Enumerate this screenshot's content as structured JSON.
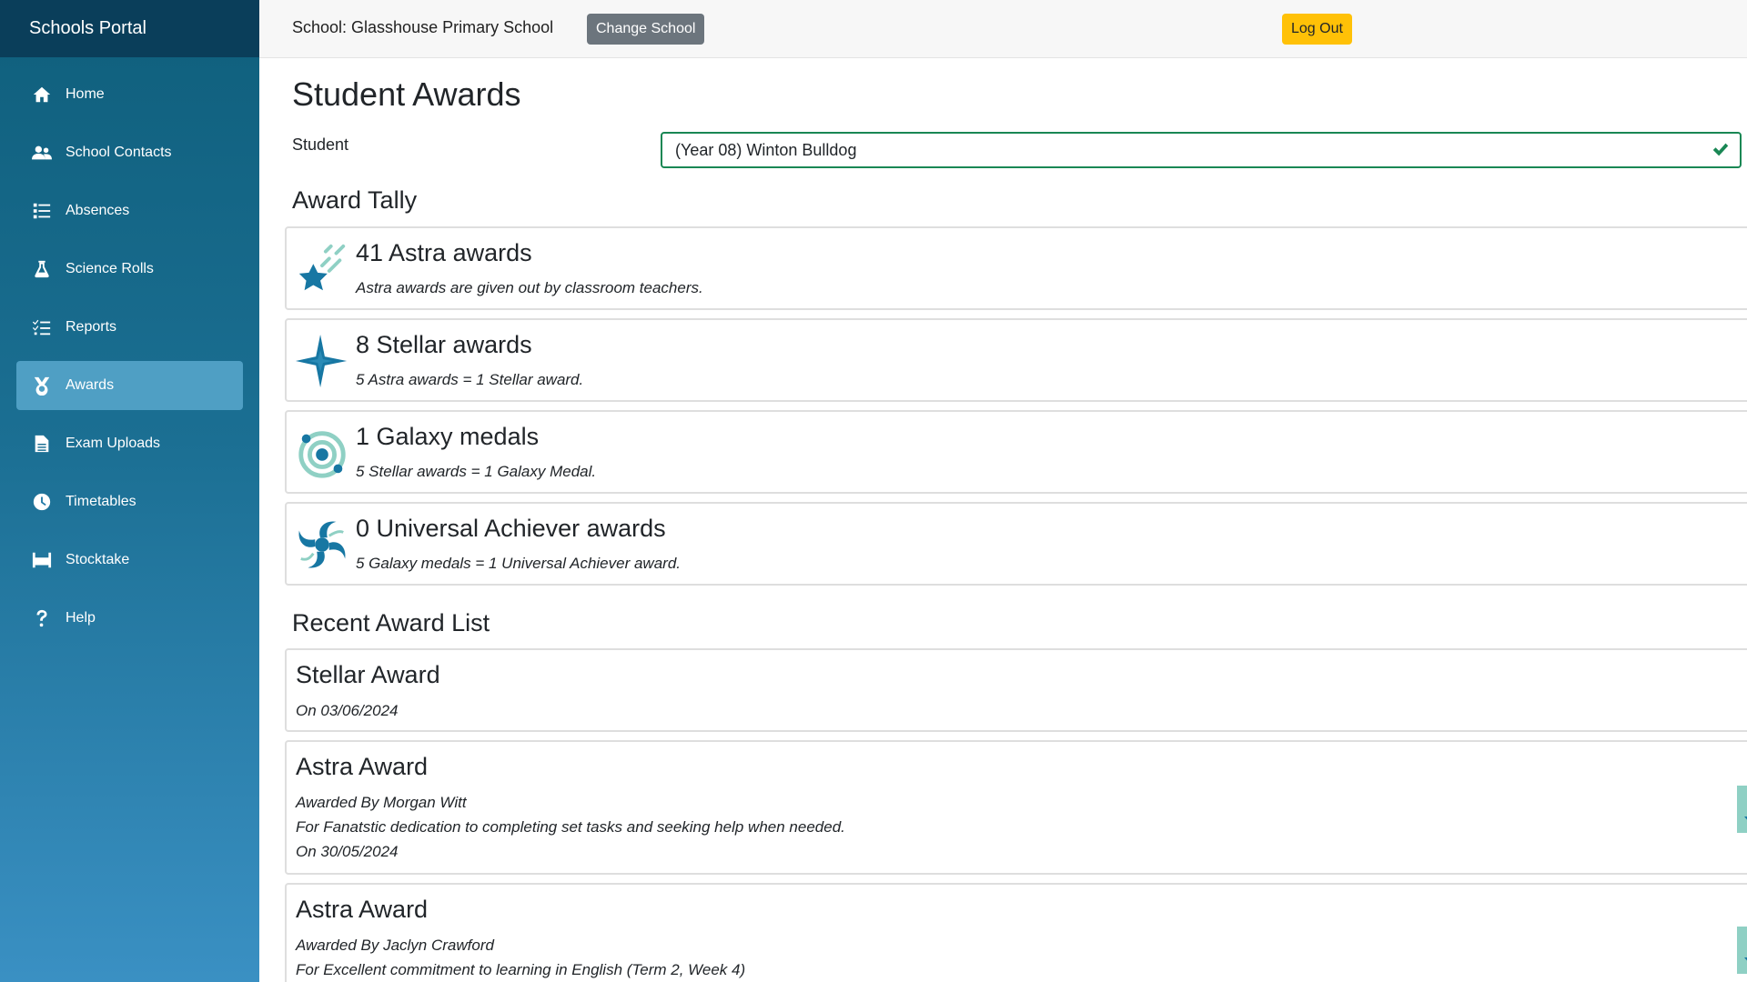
{
  "app": {
    "brand": "Schools Portal"
  },
  "sidebar": {
    "items": [
      {
        "label": "Home",
        "icon": "home-icon"
      },
      {
        "label": "School Contacts",
        "icon": "users-icon"
      },
      {
        "label": "Absences",
        "icon": "list-icon"
      },
      {
        "label": "Science Rolls",
        "icon": "flask-icon"
      },
      {
        "label": "Reports",
        "icon": "list-check-icon"
      },
      {
        "label": "Awards",
        "icon": "medal-icon",
        "active": true
      },
      {
        "label": "Exam Uploads",
        "icon": "file-icon"
      },
      {
        "label": "Timetables",
        "icon": "clock-icon"
      },
      {
        "label": "Stocktake",
        "icon": "warehouse-icon"
      },
      {
        "label": "Help",
        "icon": "question-icon"
      }
    ]
  },
  "topbar": {
    "school_label": "School: Glasshouse Primary School",
    "change_school": "Change School",
    "logout": "Log Out"
  },
  "page": {
    "title": "Student Awards",
    "student_label": "Student",
    "student_value": "(Year 08) Winton Bulldog"
  },
  "tally": {
    "title": "Award Tally",
    "items": [
      {
        "title": "41 Astra awards",
        "desc": "Astra awards are given out by classroom teachers.",
        "icon": "shooting-star-icon"
      },
      {
        "title": "8 Stellar awards",
        "desc": "5 Astra awards = 1 Stellar award.",
        "icon": "sparkle-star-icon"
      },
      {
        "title": "1 Galaxy medals",
        "desc": "5 Stellar awards = 1 Galaxy Medal.",
        "icon": "orbit-icon"
      },
      {
        "title": "0 Universal Achiever awards",
        "desc": "5 Galaxy medals = 1 Universal Achiever award.",
        "icon": "spiral-galaxy-icon"
      }
    ]
  },
  "recent": {
    "title": "Recent Award List",
    "items": [
      {
        "title": "Stellar Award",
        "on": "On 03/06/2024"
      },
      {
        "title": "Astra Award",
        "by": "Awarded By Morgan Witt",
        "for": "For Fanatstic dedication to completing set tasks and seeking help when needed.",
        "on": "On 30/05/2024",
        "icon": "download-file-icon"
      },
      {
        "title": "Astra Award",
        "by": "Awarded By Jaclyn Crawford",
        "for": "For Excellent commitment to learning in English (Term 2, Week 4)",
        "icon": "download-file-icon"
      }
    ]
  },
  "colors": {
    "sidebar_top": "#0f5f7c",
    "sidebar_bottom": "#3a90c3",
    "brand_bar": "#0a3e5a",
    "active_item": "#4f9fc4",
    "success": "#198754",
    "warning": "#ffc107",
    "secondary": "#6c757d",
    "icon_blue": "#1777a3",
    "icon_teal": "#8fd0c4"
  }
}
